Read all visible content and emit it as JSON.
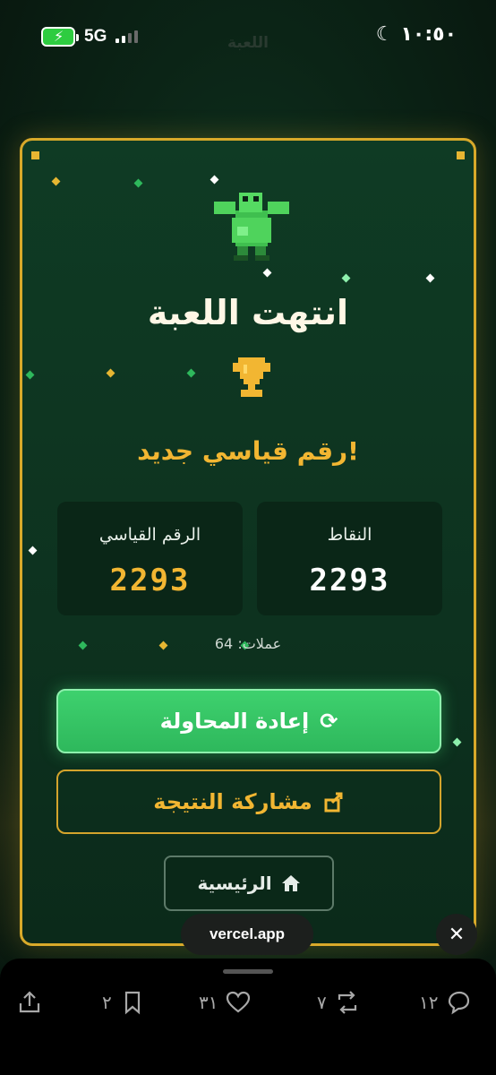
{
  "status_bar": {
    "network": "5G",
    "time": "١٠:٥٠"
  },
  "page": {
    "ghost_title": "اللعبة"
  },
  "game_over": {
    "title": "انتهت اللعبة",
    "new_record_text": "رقم قياسي جديد!",
    "score_label": "النقاط",
    "score_value": "2293",
    "best_label": "الرقم القياسي",
    "best_value": "2293",
    "coins_text": "عملات: 64",
    "retry_label": "إعادة المحاولة",
    "share_label": "مشاركة النتيجة",
    "home_label": "الرئيسية"
  },
  "browser": {
    "url": "vercel.app"
  },
  "actions": {
    "replies": "١٢",
    "reposts": "٧",
    "likes": "٣١",
    "bookmarks": "٢"
  },
  "colors": {
    "accent_gold": "#f2b632",
    "accent_green": "#3ed16e",
    "card_bg": "#0f3b24"
  },
  "icons": [
    "battery-icon",
    "signal-icon",
    "moon-icon",
    "mascot-icon",
    "trophy-icon",
    "refresh-icon",
    "share-icon",
    "home-icon",
    "close-icon",
    "reply-icon",
    "repost-icon",
    "heart-icon",
    "bookmark-icon",
    "upload-icon"
  ]
}
